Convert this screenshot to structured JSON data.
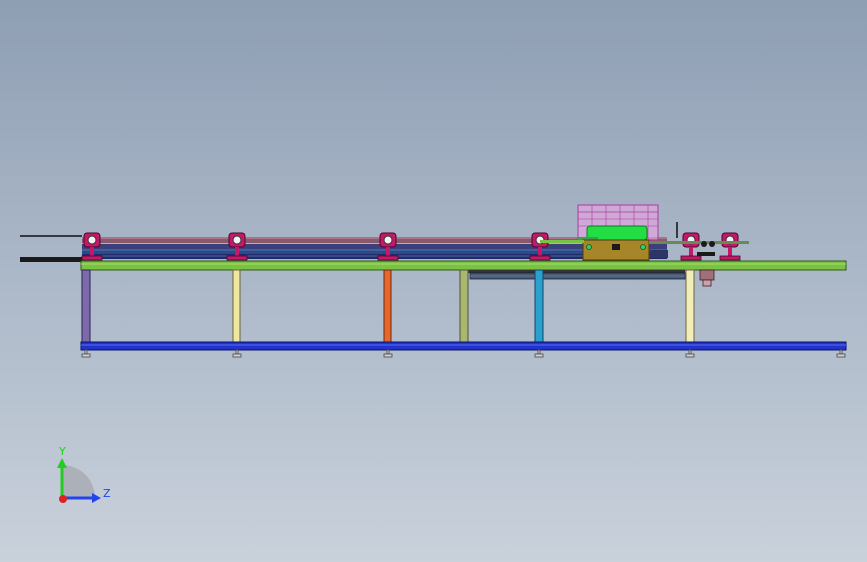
{
  "viewport": {
    "background_top": "#8e9eb3",
    "background_bottom": "#c9d1db"
  },
  "model": {
    "frame_color": "#7bc144",
    "base_rail_color": "#2233cc",
    "leg_colors": [
      "#7d6aa8",
      "#efe6a0",
      "#e8662a",
      "#a8b870",
      "#2a9fd0",
      "#f2eeb8"
    ],
    "roller_color": "#c4196b",
    "motor_color": "#22dd44",
    "gearbox_color": "#a7862a",
    "guard_color": "#f0a0e6",
    "shaft_color": "#9b6c7a"
  },
  "triad": {
    "y_label": "Y",
    "z_label": "Z",
    "y_color": "#22cc22",
    "z_color": "#2244ee",
    "origin_color": "#dd2222"
  }
}
